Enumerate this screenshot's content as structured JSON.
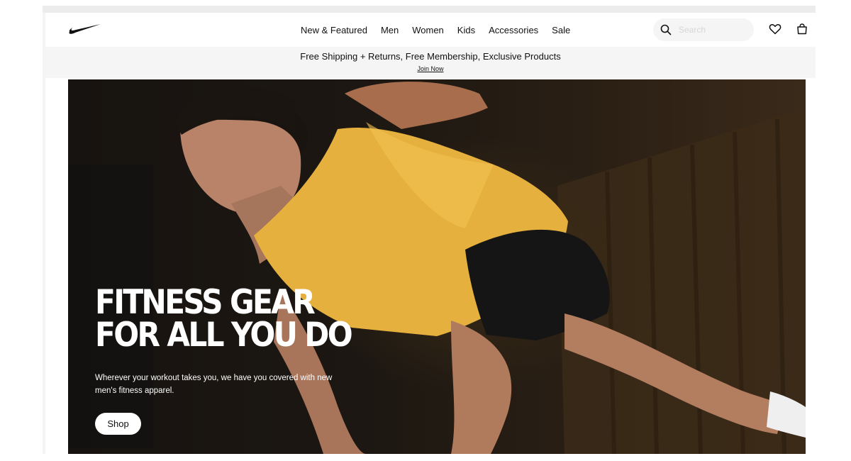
{
  "brand": {
    "logo_icon": "nike-swoosh-icon"
  },
  "nav": {
    "items": [
      {
        "label": "New & Featured"
      },
      {
        "label": "Men"
      },
      {
        "label": "Women"
      },
      {
        "label": "Kids"
      },
      {
        "label": "Accessories"
      },
      {
        "label": "Sale"
      }
    ]
  },
  "search": {
    "placeholder": "Search",
    "icon": "search-icon"
  },
  "icons": {
    "favorites": "heart-icon",
    "bag": "bag-icon"
  },
  "promo": {
    "text": "Free Shipping + Returns, Free Membership, Exclusive Products",
    "link": "Join Now"
  },
  "hero": {
    "headline_line1": "FITNESS GEAR",
    "headline_line2": "FOR ALL YOU DO",
    "subtext": "Wherever your workout takes you, we have you covered with new men's fitness apparel.",
    "cta_label": "Shop"
  },
  "colors": {
    "promo_bg": "#f5f5f5",
    "shirt_yellow": "#e8b23c",
    "hero_dark": "#1a1511"
  }
}
